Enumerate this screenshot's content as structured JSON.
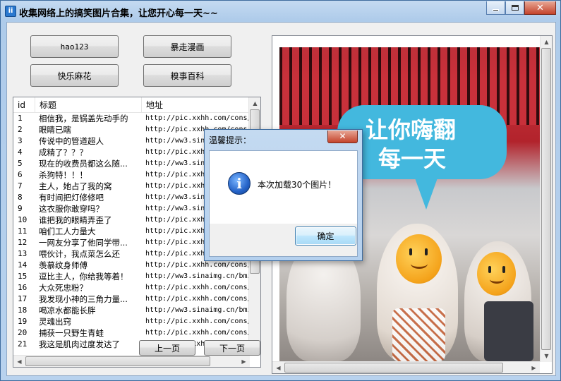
{
  "window": {
    "title": "收集网络上的搞笑图片合集，让您开心每一天~~",
    "icon_label": "ii"
  },
  "buttons": {
    "hao123": "hao123",
    "baozou": "暴走漫画",
    "kuaile": "快乐麻花",
    "qiushi": "糗事百科"
  },
  "list": {
    "columns": [
      "id",
      "标题",
      "地址"
    ],
    "rows": [
      {
        "id": "1",
        "title": "相信我，是锅盖先动手的",
        "url": "http://pic.xxhh.com/cons/"
      },
      {
        "id": "2",
        "title": "眼睛已瞎",
        "url": "http://pic.xxhh.com/cons/"
      },
      {
        "id": "3",
        "title": "传说中的管道超人",
        "url": "http://ww3.sinaimg.cn/bmi"
      },
      {
        "id": "4",
        "title": "成精了？？？",
        "url": "http://pic.xxhh.com/cons/"
      },
      {
        "id": "5",
        "title": "现在的收费员都这么随...",
        "url": "http://ww3.sinaimg.cn/bmi"
      },
      {
        "id": "6",
        "title": "杀狗特！！！",
        "url": "http://pic.xxhh.com/cons/"
      },
      {
        "id": "7",
        "title": "主人，她占了我的窝",
        "url": "http://pic.xxhh.com/cons/"
      },
      {
        "id": "8",
        "title": "有时间把灯修修吧",
        "url": "http://ww3.sinaimg.cn/bmi"
      },
      {
        "id": "9",
        "title": "这衣服你敢穿吗？",
        "url": "http://ww3.sinaimg.cn/bmi"
      },
      {
        "id": "10",
        "title": "谁把我的眼睛弄歪了",
        "url": "http://pic.xxhh.com/cons/"
      },
      {
        "id": "11",
        "title": "咱们工人力量大",
        "url": "http://pic.xxhh.com/cons/"
      },
      {
        "id": "12",
        "title": "一网友分享了他同学带...",
        "url": "http://pic.xxhh.com/cons/"
      },
      {
        "id": "13",
        "title": "喂伙计，我点菜怎么还",
        "url": "http://pic.xxhh.com/cons/"
      },
      {
        "id": "14",
        "title": "羡慕纹身师傅",
        "url": "http://pic.xxhh.com/cons/"
      },
      {
        "id": "15",
        "title": "逗比主人，你给我等着！",
        "url": "http://ww3.sinaimg.cn/bmi"
      },
      {
        "id": "16",
        "title": "大众死忠粉？",
        "url": "http://pic.xxhh.com/cons/"
      },
      {
        "id": "17",
        "title": "我发现小神的三角力量...",
        "url": "http://pic.xxhh.com/cons/"
      },
      {
        "id": "18",
        "title": "喝凉水都能长胖",
        "url": "http://ww3.sinaimg.cn/bmi"
      },
      {
        "id": "19",
        "title": "灵魂出窍",
        "url": "http://pic.xxhh.com/cons/"
      },
      {
        "id": "20",
        "title": "捕获一只野生青蛙",
        "url": "http://pic.xxhh.com/cons/"
      },
      {
        "id": "21",
        "title": "我这是肌肉过度发达了",
        "url": "http://pic.xxhh.com/cons/"
      }
    ]
  },
  "pager": {
    "prev": "上一页",
    "next": "下一页"
  },
  "picture": {
    "caption_line1": "让你嗨翻",
    "caption_line2": "每一天"
  },
  "dialog": {
    "title": "温馨提示：",
    "message": "本次加载30个图片！",
    "ok": "确定",
    "icon": "information-icon"
  }
}
